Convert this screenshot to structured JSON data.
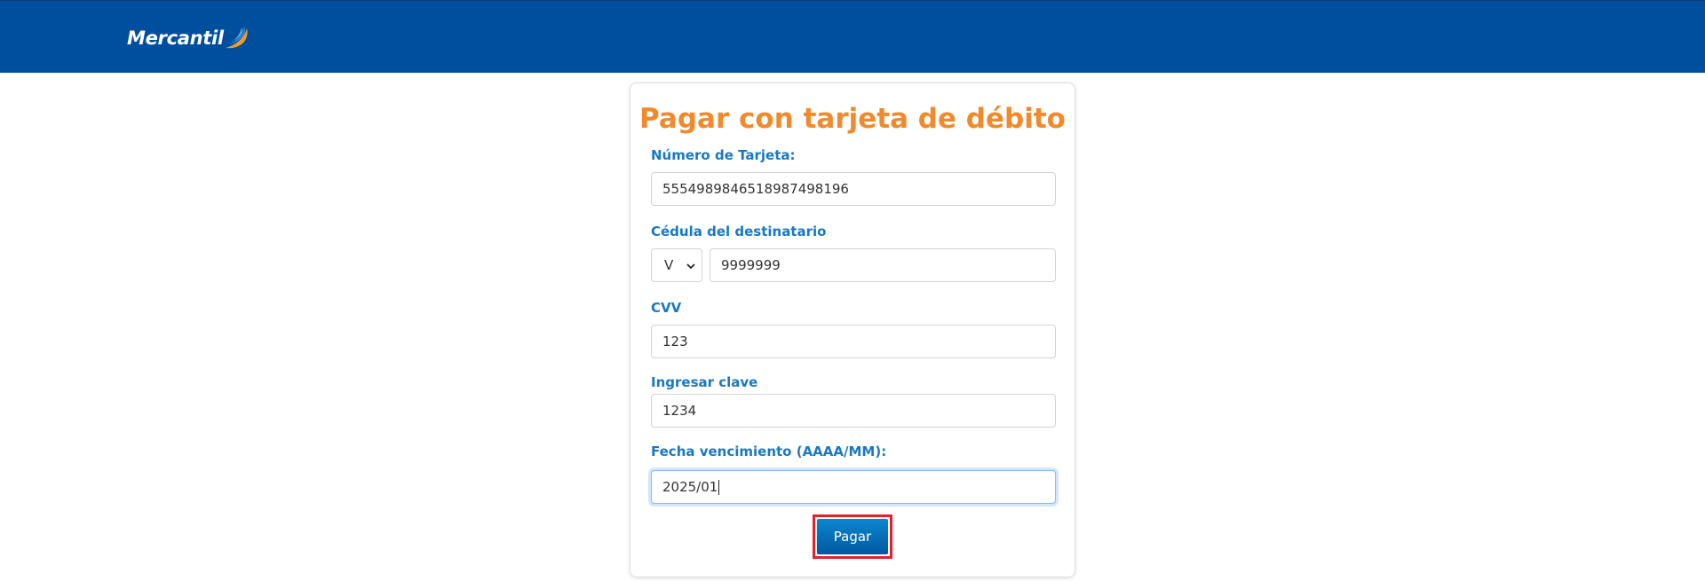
{
  "header": {
    "brand": "Mercantil",
    "logo_icon": "swoosh-icon",
    "colors": {
      "bar": "#004f9f",
      "swoosh_orange": "#f39a2b",
      "swoosh_blue": "#1e88d8"
    }
  },
  "form": {
    "title": "Pagar con tarjeta de débito",
    "title_color": "#f08a2c",
    "label_color": "#1a78c2",
    "card_number": {
      "label": "Número de Tarjeta:",
      "value": "5554989846518987498196"
    },
    "recipient_id": {
      "label": "Cédula del destinatario",
      "type_value": "V",
      "value": "9999999"
    },
    "cvv": {
      "label": "CVV",
      "value": "123"
    },
    "password": {
      "label": "Ingresar clave",
      "value": "1234"
    },
    "expiry": {
      "label": "Fecha vencimiento (AAAA/MM):",
      "value": "2025/01"
    },
    "submit_label": "Pagar"
  }
}
